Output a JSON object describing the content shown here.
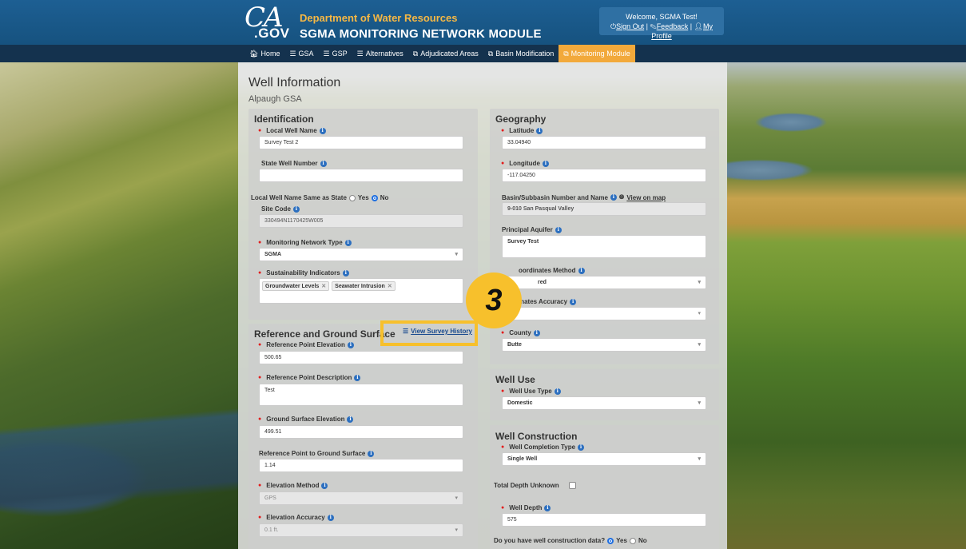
{
  "header": {
    "logo_ca": "CA",
    "logo_gov": ".GOV",
    "department": "Department of Water Resources",
    "app_name": "SGMA MONITORING NETWORK MODULE",
    "welcome": "Welcome, SGMA Test!",
    "sign_out": "Sign Out",
    "feedback": "Feedback",
    "my_profile": "My Profile"
  },
  "nav": {
    "items": [
      {
        "icon": "home-icon",
        "glyph": "🏠︎",
        "label": "Home"
      },
      {
        "icon": "list-icon",
        "glyph": "☰",
        "label": "GSA"
      },
      {
        "icon": "list-icon",
        "glyph": "☰",
        "label": "GSP"
      },
      {
        "icon": "list-icon",
        "glyph": "☰",
        "label": "Alternatives"
      },
      {
        "icon": "external-link-icon",
        "glyph": "⧉",
        "label": "Adjudicated Areas"
      },
      {
        "icon": "external-link-icon",
        "glyph": "⧉",
        "label": "Basin Modification"
      },
      {
        "icon": "external-link-icon",
        "glyph": "⧉",
        "label": "Monitoring Module"
      }
    ],
    "active_index": 6
  },
  "page": {
    "title": "Well Information",
    "subtitle": "Alpaugh GSA"
  },
  "identification": {
    "title": "Identification",
    "local_well_name_label": "Local Well Name",
    "local_well_name": "Survey Test 2",
    "state_well_number_label": "State Well Number",
    "state_well_number": "",
    "same_as_state_label": "Local Well Name Same as State",
    "yes": "Yes",
    "no": "No",
    "site_code_label": "Site Code",
    "site_code": "330494N1170425W005",
    "network_type_label": "Monitoring Network Type",
    "network_type": "SGMA",
    "indicators_label": "Sustainability Indicators",
    "indicators": [
      "Groundwater Levels",
      "Seawater Intrusion"
    ]
  },
  "reference": {
    "title": "Reference and Ground Surface",
    "survey_history": "View Survey History",
    "rp_elev_label": "Reference Point Elevation",
    "rp_elev": "500.65",
    "rp_desc_label": "Reference Point Description",
    "rp_desc": "Test",
    "gs_elev_label": "Ground Surface Elevation",
    "gs_elev": "499.51",
    "rp_to_gs_label": "Reference Point to Ground Surface",
    "rp_to_gs": "1.14",
    "elev_method_label": "Elevation Method",
    "elev_method": "GPS",
    "elev_accuracy_label": "Elevation Accuracy",
    "elev_accuracy": "0.1 ft."
  },
  "geography": {
    "title": "Geography",
    "lat_label": "Latitude",
    "lat": "33.04940",
    "lon_label": "Longitude",
    "lon": "-117.04250",
    "basin_label": "Basin/Subbasin Number and Name",
    "view_on_map": "View on map",
    "basin": "9-010 San Pasqual Valley",
    "aquifer_label": "Principal Aquifer",
    "aquifer": "Survey Test",
    "coord_method_label": "oordinates Method",
    "coord_method": "red",
    "coord_accuracy_label": "inates Accuracy",
    "coord_accuracy": "",
    "county_label": "County",
    "county": "Butte"
  },
  "well_use": {
    "title": "Well Use",
    "type_label": "Well Use Type",
    "type": "Domestic"
  },
  "construction": {
    "title": "Well Construction",
    "completion_label": "Well Completion Type",
    "completion": "Single Well",
    "depth_unknown_label": "Total Depth Unknown",
    "depth_label": "Well Depth",
    "depth": "575",
    "have_data_label": "Do you have well construction data?",
    "yes": "Yes",
    "no": "No"
  },
  "step_badge": "3",
  "colors": {
    "header": "#1d5f93",
    "nav": "#14324e",
    "active_tab": "#f2a93b",
    "highlight": "#f7c02c",
    "required": "#e21e1e"
  }
}
